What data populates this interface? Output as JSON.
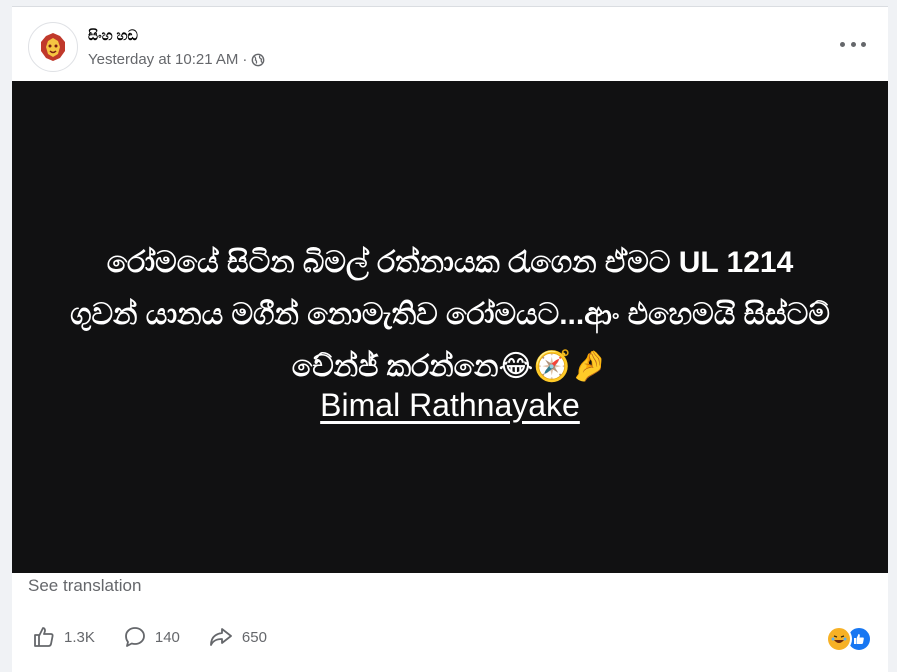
{
  "post": {
    "page_name": "සිංහ හඩ",
    "time": "Yesterday at 10:21 AM",
    "separator": "·",
    "privacy_icon": "globe-icon",
    "more_icon": "more-options-icon",
    "image_text": "රෝමයේ සිටින බිමල් රත්නායක රැගෙන ඒමට UL 1214 ගුවන් යානය මගීන් නොමැතිව රෝමයට...ආං එහෙමයි සිස්ටම් චේන්ජ් කරන්නෙ😂🧭🤌",
    "image_author": "Bimal Rathnayake",
    "see_translation": "See translation"
  },
  "actions": {
    "likes": "1.3K",
    "comments": "140",
    "shares": "650"
  },
  "reactions": [
    "laughing-emoji",
    "like-icon"
  ],
  "colors": {
    "image_bg": "#111112",
    "secondary_text": "#65676b",
    "like_blue": "#1877f2"
  }
}
